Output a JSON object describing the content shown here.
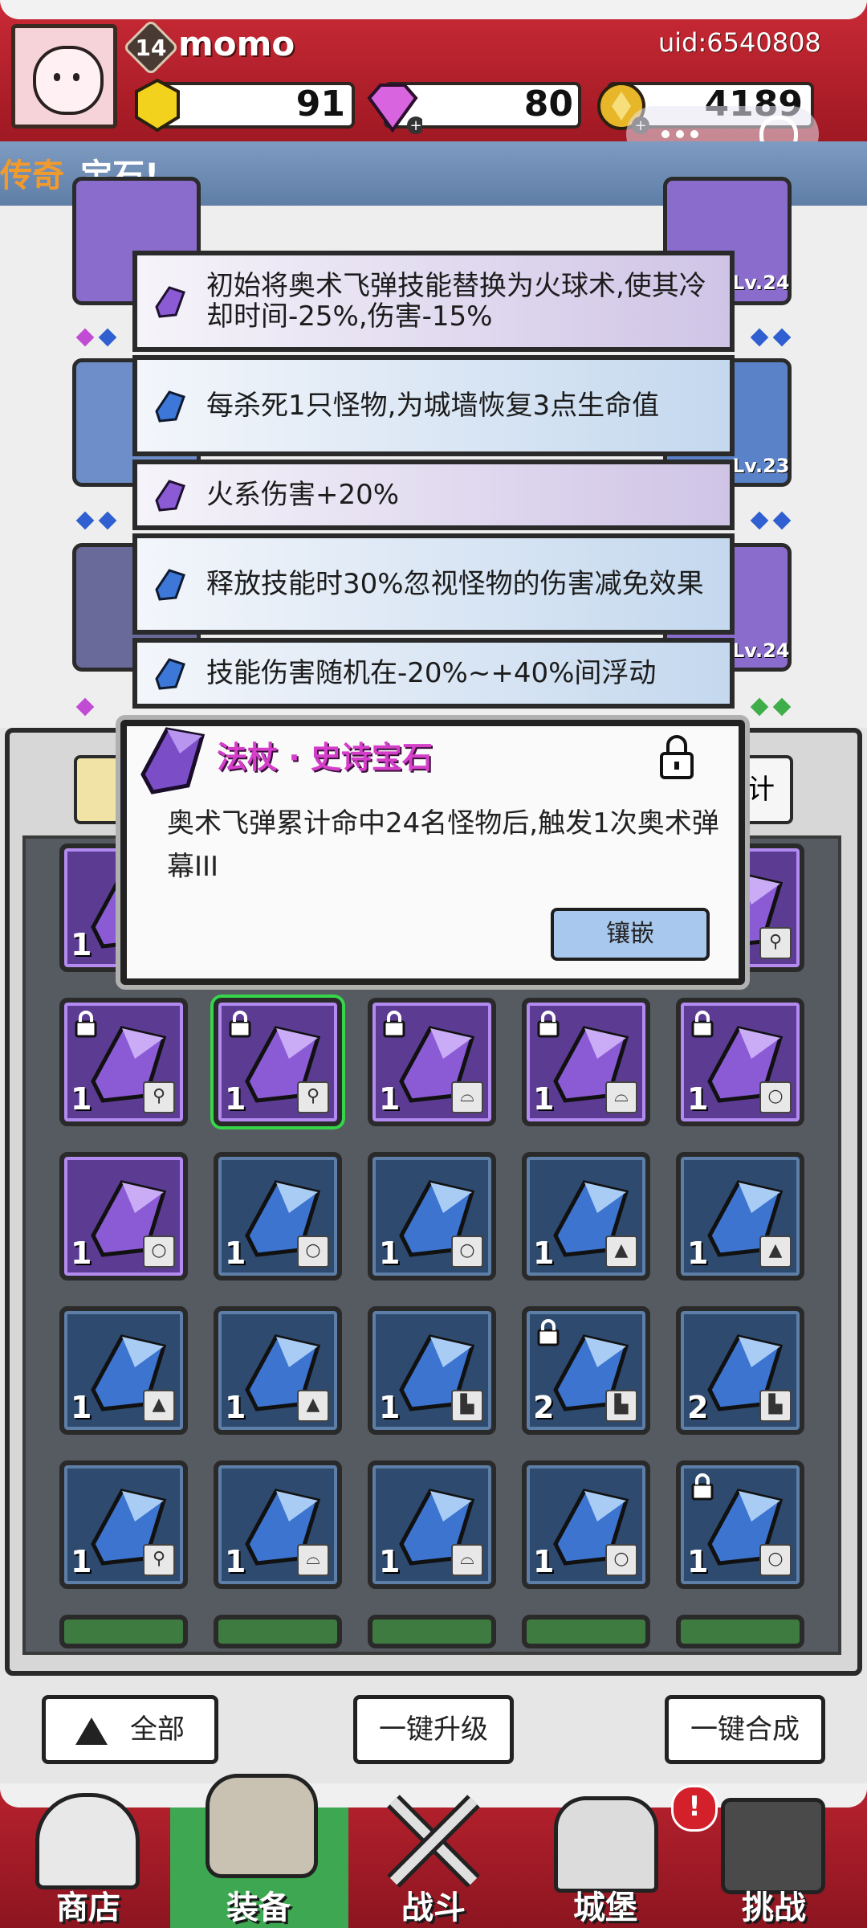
{
  "header": {
    "level": "14",
    "username": "momo",
    "uid": "uid:6540808",
    "gold": "91",
    "gems": "80",
    "coins": "4189"
  },
  "banner": {
    "prefix": "传奇",
    "text": "宝石!"
  },
  "equipment_levels": [
    "Lv.24",
    "Lv.23",
    "Lv.24"
  ],
  "affixes": [
    {
      "text": "初始将奥术飞弹技能替换为火球术,使其冷却时间-25%,伤害-15%",
      "color": "purple"
    },
    {
      "text": "每杀死1只怪物,为城墙恢复3点生命值",
      "color": "blue"
    },
    {
      "text": "火系伤害+20%",
      "color": "purple"
    },
    {
      "text": "释放技能时30%忽视怪物的伤害减免效果",
      "color": "blue"
    },
    {
      "text": "技能伤害随机在-20%~+40%间浮动",
      "color": "blue"
    }
  ],
  "popup": {
    "title": "法杖 · 史诗宝石",
    "description": "奥术飞弹累计命中24名怪物后,触发1次奥术弹幕III",
    "inlay_button": "镶嵌"
  },
  "inventory_rows": [
    [
      {
        "quality": "purple",
        "qty": "1",
        "locked": false,
        "type_icon": "staff"
      },
      {
        "quality": "hidden"
      },
      {
        "quality": "hidden"
      },
      {
        "quality": "hidden"
      },
      {
        "quality": "purple",
        "qty": "",
        "locked": false,
        "type_icon": "staff"
      }
    ],
    [
      {
        "quality": "purple",
        "qty": "1",
        "locked": true,
        "type_icon": "staff"
      },
      {
        "quality": "purple",
        "qty": "1",
        "locked": true,
        "type_icon": "staff",
        "selected": true
      },
      {
        "quality": "purple",
        "qty": "1",
        "locked": true,
        "type_icon": "hat"
      },
      {
        "quality": "purple",
        "qty": "1",
        "locked": true,
        "type_icon": "hat"
      },
      {
        "quality": "purple",
        "qty": "1",
        "locked": true,
        "type_icon": "ring"
      }
    ],
    [
      {
        "quality": "purple",
        "qty": "1",
        "locked": false,
        "type_icon": "ring"
      },
      {
        "quality": "blue",
        "qty": "1",
        "locked": false,
        "type_icon": "ring"
      },
      {
        "quality": "blue",
        "qty": "1",
        "locked": false,
        "type_icon": "ring"
      },
      {
        "quality": "blue",
        "qty": "1",
        "locked": false,
        "type_icon": "armor"
      },
      {
        "quality": "blue",
        "qty": "1",
        "locked": false,
        "type_icon": "armor"
      }
    ],
    [
      {
        "quality": "blue",
        "qty": "1",
        "locked": false,
        "type_icon": "armor"
      },
      {
        "quality": "blue",
        "qty": "1",
        "locked": false,
        "type_icon": "armor"
      },
      {
        "quality": "blue",
        "qty": "1",
        "locked": false,
        "type_icon": "boot"
      },
      {
        "quality": "blue",
        "qty": "2",
        "locked": true,
        "type_icon": "boot"
      },
      {
        "quality": "blue",
        "qty": "2",
        "locked": false,
        "type_icon": "boot"
      }
    ],
    [
      {
        "quality": "blue",
        "qty": "1",
        "locked": false,
        "type_icon": "staff"
      },
      {
        "quality": "blue",
        "qty": "1",
        "locked": false,
        "type_icon": "hat"
      },
      {
        "quality": "blue",
        "qty": "1",
        "locked": false,
        "type_icon": "hat"
      },
      {
        "quality": "blue",
        "qty": "1",
        "locked": false,
        "type_icon": "ring"
      },
      {
        "quality": "blue",
        "qty": "1",
        "locked": true,
        "type_icon": "ring"
      }
    ]
  ],
  "actions": {
    "filter_label": "全部",
    "upgrade_all": "一键升级",
    "merge_all": "一键合成",
    "partial_right_label": "计"
  },
  "nav": {
    "items": [
      "商店",
      "装备",
      "战斗",
      "城堡",
      "挑战"
    ],
    "active": "装备",
    "badge": "!"
  },
  "colors": {
    "header_red": "#b9202c",
    "epic_purple": "#5c3c93",
    "rare_blue": "#2e4a6e",
    "title_magenta": "#d43ec9",
    "nav_active_green": "#3da851",
    "legend_orange": "#f39a2c"
  }
}
